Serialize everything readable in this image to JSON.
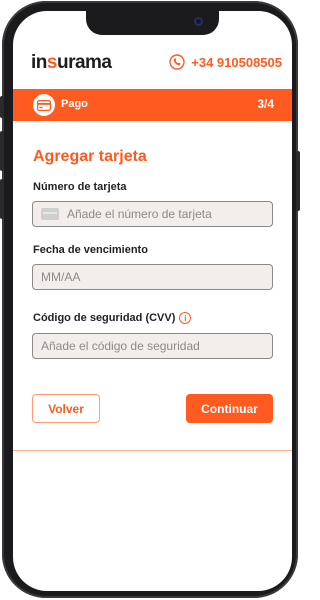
{
  "brand": {
    "logo_prefix": "in",
    "logo_o": "s",
    "logo_rest": "urama",
    "accent": "#ff5a1f"
  },
  "header": {
    "phone": "+34 910508505",
    "phone_icon": "phone-icon"
  },
  "step": {
    "label": "Pago",
    "counter": "3/4",
    "icon": "credit-card-icon"
  },
  "form": {
    "title": "Agregar tarjeta",
    "card_number": {
      "label": "Número de tarjeta",
      "placeholder": "Añade el número de tarjeta"
    },
    "expiry": {
      "label": "Fecha de vencimiento",
      "placeholder": "MM/AA"
    },
    "cvv": {
      "label": "Código de seguridad (CVV)",
      "placeholder": "Añade el código de seguridad",
      "info_icon": "info-icon"
    }
  },
  "buttons": {
    "back": "Volver",
    "continue": "Continuar"
  }
}
